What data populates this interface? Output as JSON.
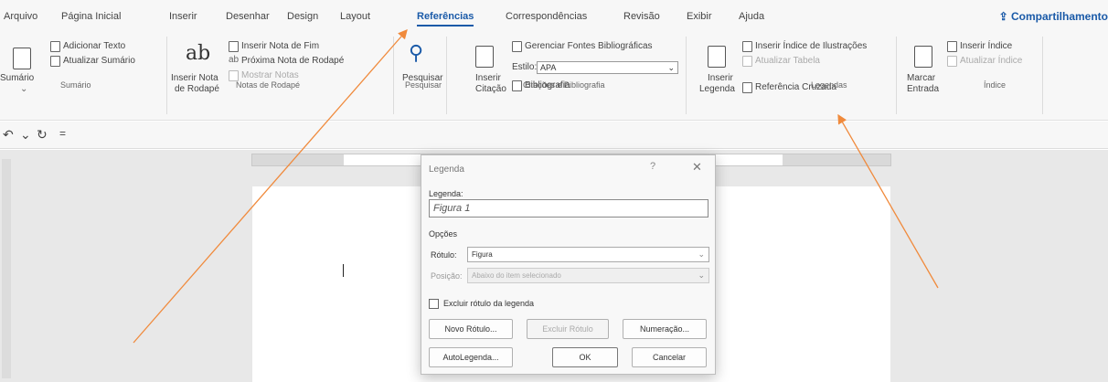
{
  "tabs": {
    "arquivo": "Arquivo",
    "pagina_inicial": "Página Inicial",
    "inserir": "Inserir",
    "desenhar": "Desenhar",
    "design": "Design",
    "layout": "Layout",
    "referencias": "Referências",
    "correspondencias": "Correspondências",
    "revisao": "Revisão",
    "exibir": "Exibir",
    "ajuda": "Ajuda"
  },
  "share_label": "Compartilhamento",
  "ribbon": {
    "sumario": {
      "big": "Sumário",
      "add_text": "Adicionar Texto",
      "update": "Atualizar Sumário",
      "group": "Sumário"
    },
    "notas": {
      "big1": "Inserir Nota",
      "big2": "de Rodapé",
      "insert_endnote": "Inserir Nota de Fim",
      "next_footnote": "Próxima Nota de Rodapé",
      "show_notes": "Mostrar Notas",
      "group": "Notas de Rodapé"
    },
    "pesquisar": {
      "big": "Pesquisar",
      "group": "Pesquisar"
    },
    "citacoes": {
      "big1": "Inserir",
      "big2": "Citação",
      "manage": "Gerenciar Fontes Bibliográficas",
      "style_label": "Estilo:",
      "style_value": "APA",
      "bibliography": "Bibliografia",
      "group": "Citações e Bibliografia"
    },
    "legendas": {
      "big1": "Inserir",
      "big2": "Legenda",
      "insert_index": "Inserir Índice de Ilustrações",
      "update_table": "Atualizar Tabela",
      "cross_ref": "Referência Cruzada",
      "group": "Legendas"
    },
    "indice": {
      "big1": "Marcar",
      "big2": "Entrada",
      "insert_index": "Inserir Índice",
      "update_index": "Atualizar Índice",
      "group": "Índice"
    }
  },
  "dialog": {
    "title": "Legenda",
    "help": "?",
    "close": "✕",
    "caption_label": "Legenda:",
    "caption_value": "Figura 1",
    "options_label": "Opções",
    "rotulo_label": "Rótulo:",
    "rotulo_value": "Figura",
    "posicao_label": "Posição:",
    "posicao_value": "Abaixo do item selecionado",
    "exclude_label": "Excluir rótulo da legenda",
    "new_label_btn": "Novo Rótulo...",
    "delete_label_btn": "Excluir Rótulo",
    "numbering_btn": "Numeração...",
    "autocaption_btn": "AutoLegenda...",
    "ok_btn": "OK",
    "cancel_btn": "Cancelar"
  },
  "colors": {
    "accent": "#1a5aa8",
    "annotation_arrow": "#f08a3c"
  }
}
